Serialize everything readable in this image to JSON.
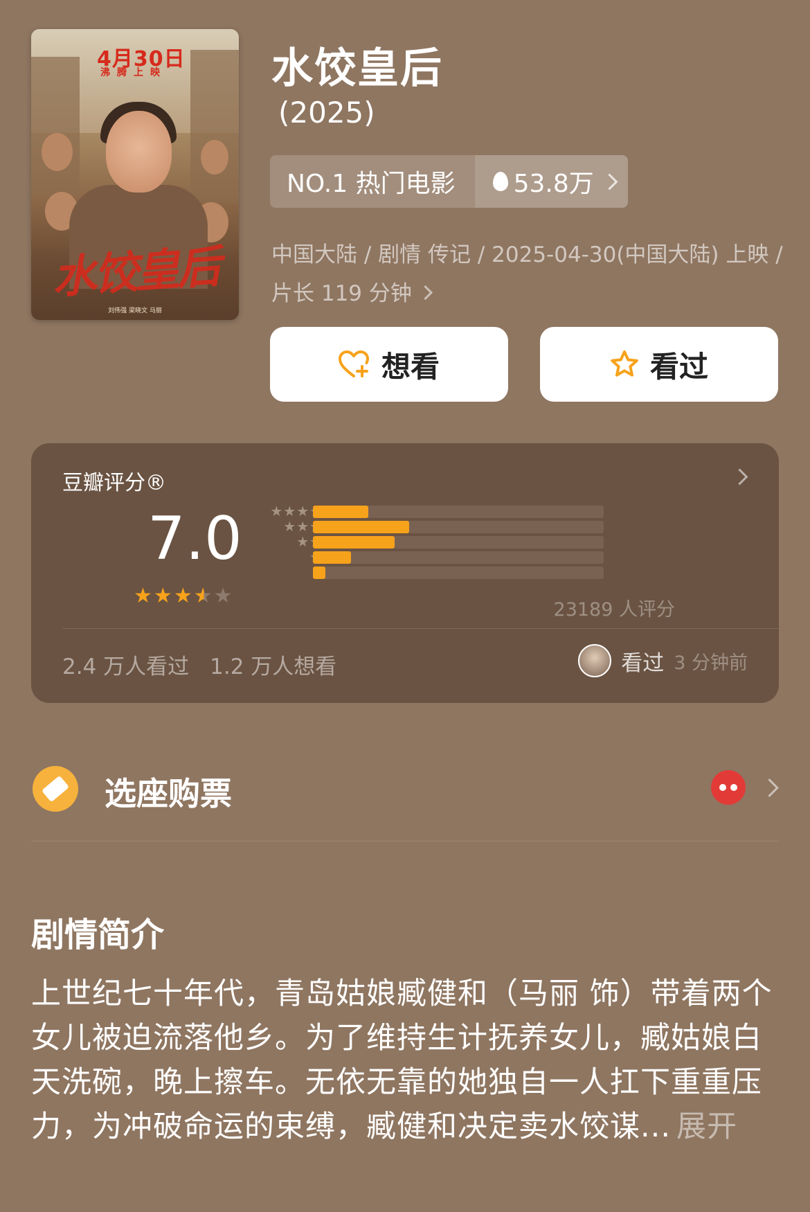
{
  "poster": {
    "date": "4月30日",
    "date_sub": "沸腾上映",
    "title": "水饺皇后",
    "credits": "刘伟强   梁晓文   马丽"
  },
  "movie": {
    "title": "水饺皇后",
    "year": "(2025)",
    "rank_label": "NO.1 热门电影",
    "heat": "53.8万",
    "meta_line": "中国大陆 / 剧情 传记 / 2025-04-30(中国大陆) 上映 / 片长 119 分钟"
  },
  "actions": {
    "want_label": "想看",
    "seen_label": "看过"
  },
  "rating": {
    "label": "豆瓣评分®",
    "score": "7.0",
    "stars": 3.5,
    "distribution": [
      {
        "stars": "★★★★★",
        "fraction": 0.19
      },
      {
        "stars": "★★★★",
        "fraction": 0.33
      },
      {
        "stars": "★★★",
        "fraction": 0.28
      },
      {
        "stars": "★★",
        "fraction": 0.13
      },
      {
        "stars": "★",
        "fraction": 0.04
      }
    ],
    "votes": "23189 人评分",
    "seen_count": "2.4 万人看过",
    "want_count": "1.2 万人想看",
    "recent_action": "看过",
    "recent_time": "3 分钟前"
  },
  "ticket": {
    "label": "选座购票"
  },
  "synopsis": {
    "heading": "剧情简介",
    "text": "上世纪七十年代，青岛姑娘臧健和（马丽 饰）带着两个女儿被迫流落他乡。为了维持生计抚养女儿，臧姑娘白天洗碗，晚上擦车。无依无靠的她独自一人扛下重重压力，为冲破命运的束缚，臧健和决定卖水饺谋...",
    "expand": "展开"
  },
  "colors": {
    "background": "#8f7661",
    "card": "#6a5342",
    "accent": "#f7a21b",
    "ticket": "#f6b23c",
    "maoyan": "#e23b37"
  }
}
